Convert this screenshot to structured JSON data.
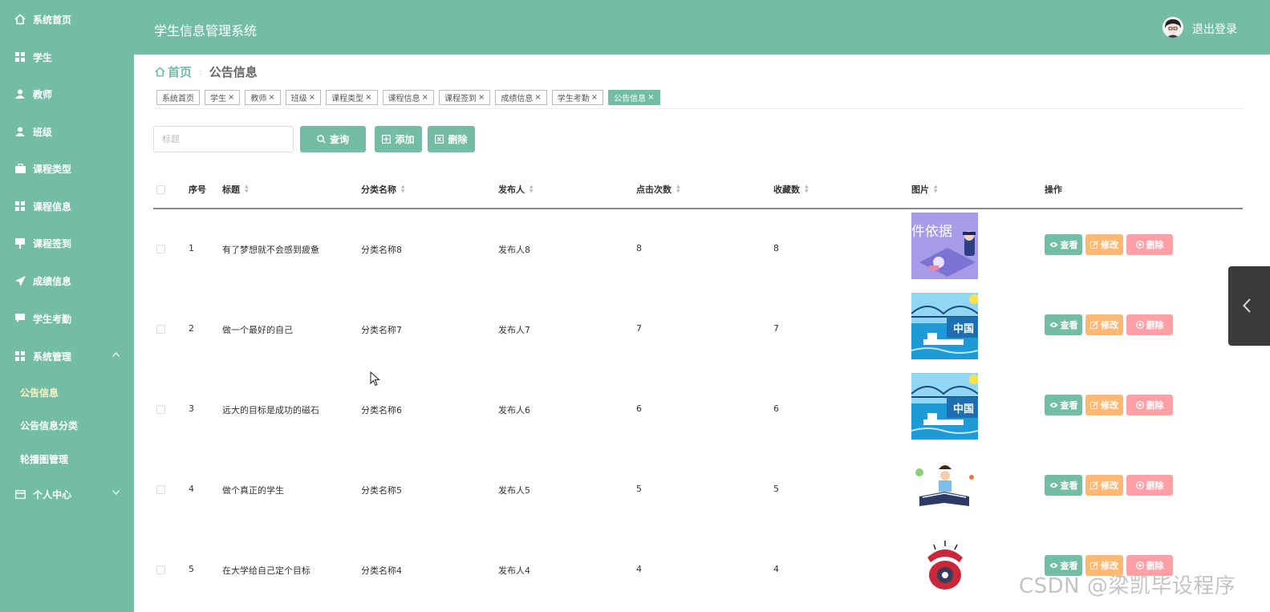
{
  "app": {
    "title": "学生信息管理系统",
    "logout_label": "退出登录"
  },
  "sidebar": {
    "items": [
      {
        "label": "系统首页",
        "icon": "home-icon"
      },
      {
        "label": "学生",
        "icon": "grid-icon"
      },
      {
        "label": "教师",
        "icon": "user-icon"
      },
      {
        "label": "班级",
        "icon": "user-icon"
      },
      {
        "label": "课程类型",
        "icon": "briefcase-icon"
      },
      {
        "label": "课程信息",
        "icon": "grid-icon"
      },
      {
        "label": "课程签到",
        "icon": "sign-icon"
      },
      {
        "label": "成绩信息",
        "icon": "paper-plane-icon"
      },
      {
        "label": "学生考勤",
        "icon": "chat-icon"
      },
      {
        "label": "系统管理",
        "icon": "grid-icon"
      }
    ],
    "submenu": [
      "公告信息",
      "公告信息分类",
      "轮播图管理"
    ],
    "personal": {
      "label": "个人中心",
      "icon": "credit-card-icon"
    }
  },
  "breadcrumb": {
    "home": "首页",
    "separator": ":",
    "current": "公告信息"
  },
  "tags": [
    "系统首页",
    "学生",
    "教师",
    "班级",
    "课程类型",
    "课程信息",
    "课程签到",
    "成绩信息",
    "学生考勤",
    "公告信息"
  ],
  "tag_close": "×",
  "toolbar": {
    "search_placeholder": "标题",
    "query_label": "查询",
    "add_label": "添加",
    "delete_label": "删除"
  },
  "table": {
    "columns": {
      "index": "序号",
      "title": "标题",
      "category": "分类名称",
      "publisher": "发布人",
      "clicks": "点击次数",
      "favorites": "收藏数",
      "image": "图片",
      "actions": "操作"
    },
    "actions": {
      "view": "查看",
      "edit": "修改",
      "delete": "删除"
    },
    "rows": [
      {
        "index": "1",
        "title": "有了梦想就不会感到疲惫",
        "category": "分类名称8",
        "publisher": "发布人8",
        "clicks": "8",
        "favorites": "8",
        "image_text": "件依据"
      },
      {
        "index": "2",
        "title": "做一个最好的自己",
        "category": "分类名称7",
        "publisher": "发布人7",
        "clicks": "7",
        "favorites": "7",
        "image_text": "中国"
      },
      {
        "index": "3",
        "title": "远大的目标是成功的磁石",
        "category": "分类名称6",
        "publisher": "发布人6",
        "clicks": "6",
        "favorites": "6",
        "image_text": "中国"
      },
      {
        "index": "4",
        "title": "做个真正的学生",
        "category": "分类名称5",
        "publisher": "发布人5",
        "clicks": "5",
        "favorites": "5",
        "image_text": ""
      },
      {
        "index": "5",
        "title": "在大学给自己定个目标",
        "category": "分类名称4",
        "publisher": "发布人4",
        "clicks": "4",
        "favorites": "4",
        "image_text": ""
      }
    ]
  },
  "watermark": "CSDN @梁凯毕设程序",
  "colors": {
    "primary": "#72bda4",
    "edit": "#ffb974",
    "delete": "#ff9fa6"
  }
}
